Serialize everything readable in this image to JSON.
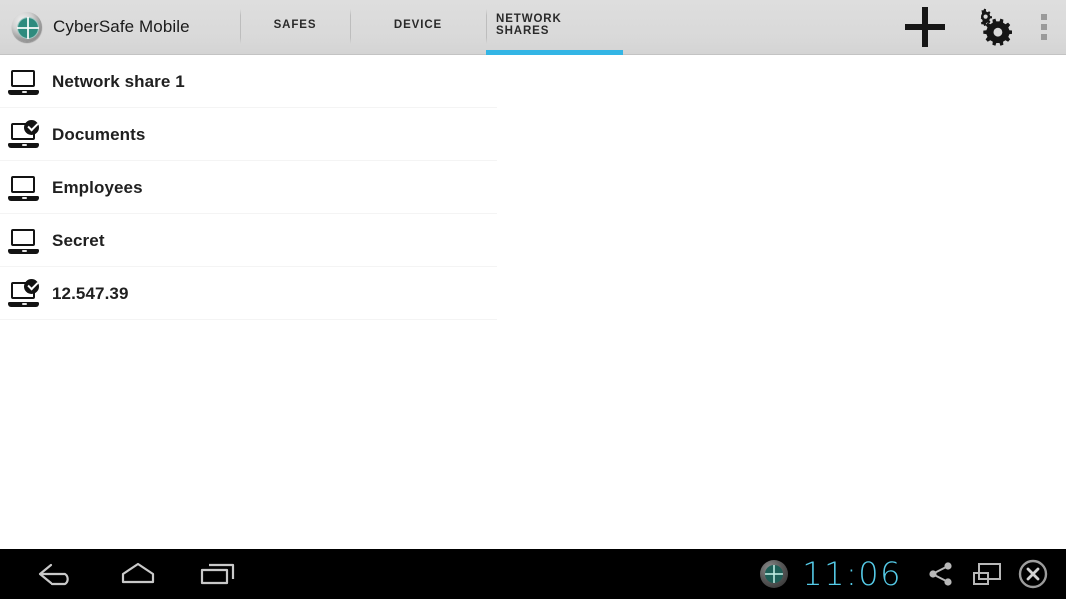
{
  "app": {
    "title": "CyberSafe Mobile",
    "logo_icon": "cybersafe-vault-icon"
  },
  "tabs": [
    {
      "label": "SAFES",
      "active": false
    },
    {
      "label": "DEVICE",
      "active": false
    },
    {
      "label": "NETWORK SHARES",
      "active": true
    }
  ],
  "actions": {
    "add_icon": "plus-icon",
    "settings_icon": "double-gear-icon",
    "overflow_icon": "overflow-menu-icon"
  },
  "colors": {
    "accent": "#33b5e5",
    "actionbar_bg": "#d9d9d9",
    "clock": "#55cbe8",
    "text": "#202020"
  },
  "list": {
    "items": [
      {
        "label": "Network share 1",
        "icon": "laptop-icon",
        "connected": false
      },
      {
        "label": "Documents",
        "icon": "laptop-check-icon",
        "connected": true
      },
      {
        "label": "Employees",
        "icon": "laptop-icon",
        "connected": false
      },
      {
        "label": "Secret",
        "icon": "laptop-icon",
        "connected": false
      },
      {
        "label": "12.547.39",
        "icon": "laptop-check-icon",
        "connected": true
      }
    ]
  },
  "system_bar": {
    "back_icon": "back-arrow-icon",
    "home_icon": "home-icon",
    "recents_icon": "recent-apps-icon",
    "app_icon": "cybersafe-status-icon",
    "clock": "11:06",
    "share_icon": "share-icon",
    "screenshot_icon": "screenshot-icon",
    "close_icon": "close-circle-icon"
  }
}
